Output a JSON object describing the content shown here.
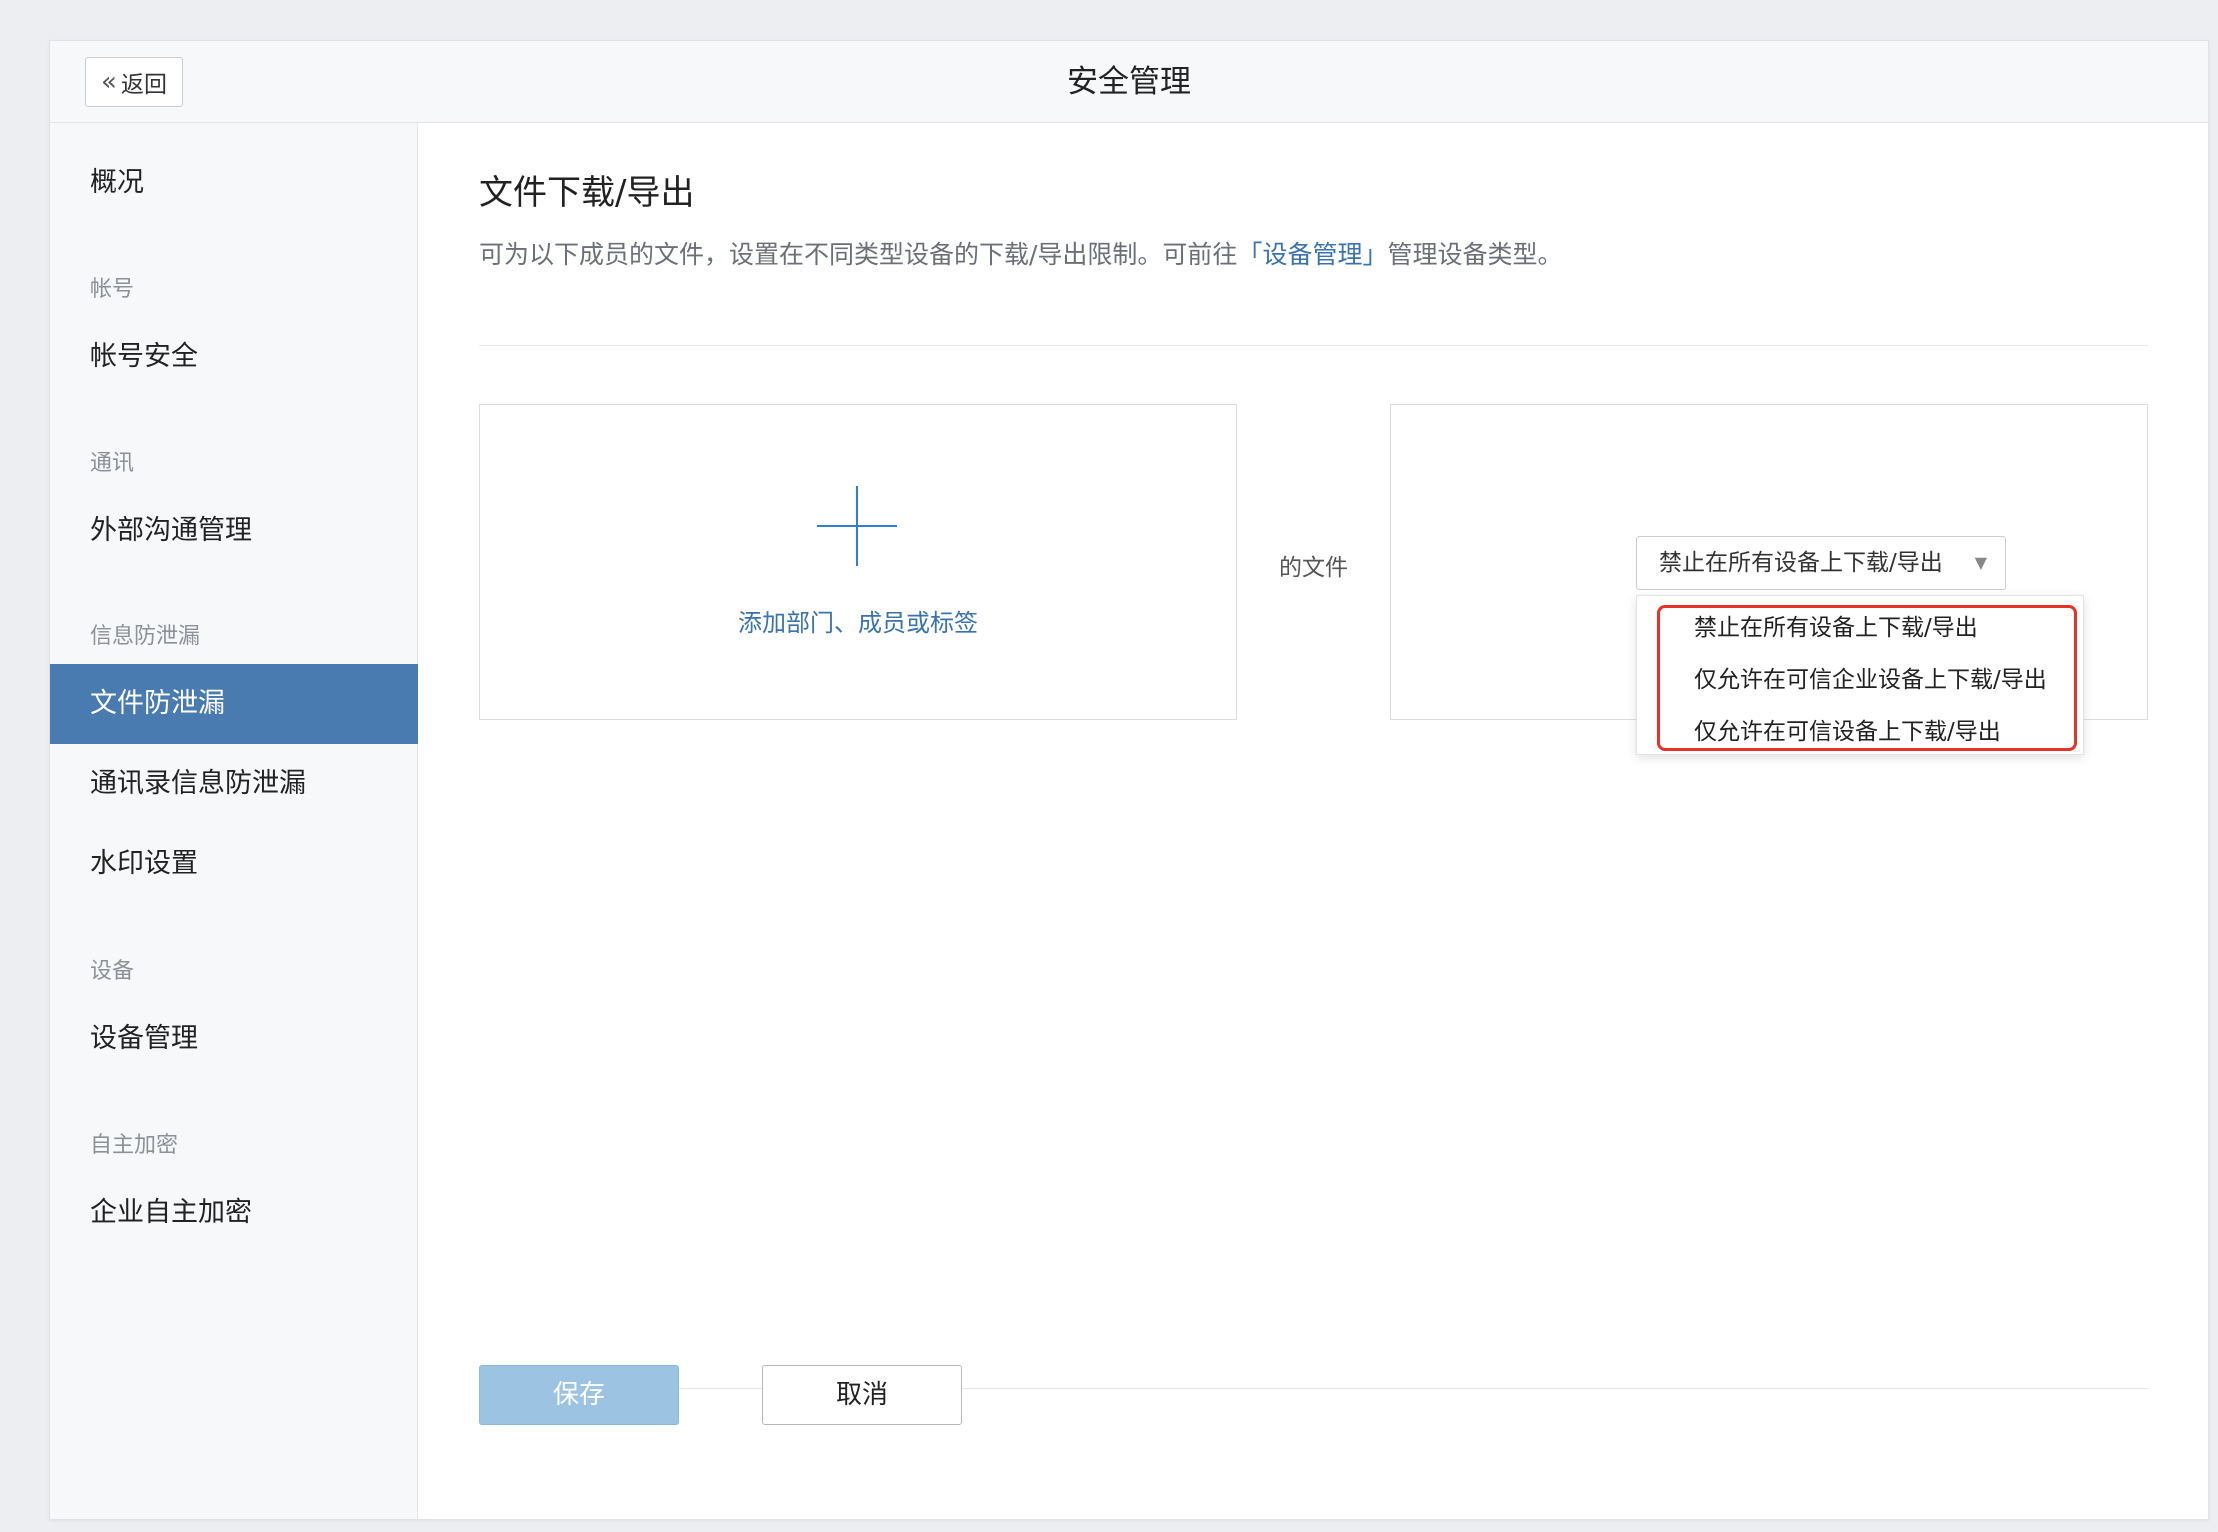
{
  "header": {
    "back_label": "返回",
    "title": "安全管理"
  },
  "sidebar": {
    "overview": "概况",
    "groups": [
      {
        "label": "帐号",
        "items": [
          "帐号安全"
        ]
      },
      {
        "label": "通讯",
        "items": [
          "外部沟通管理"
        ]
      },
      {
        "label": "信息防泄漏",
        "items": [
          "文件防泄漏",
          "通讯录信息防泄漏",
          "水印设置"
        ]
      },
      {
        "label": "设备",
        "items": [
          "设备管理"
        ]
      },
      {
        "label": "自主加密",
        "items": [
          "企业自主加密"
        ]
      }
    ],
    "active_item": "文件防泄漏"
  },
  "main": {
    "title": "文件下载/导出",
    "description_prefix": "可为以下成员的文件，设置在不同类型设备的下载/导出限制。可前往",
    "description_link": "「设备管理」",
    "description_suffix": "管理设备类型。",
    "add_label": "添加部门、成员或标签",
    "of_files": "的文件",
    "select_value": "禁止在所有设备上下载/导出",
    "options": [
      "禁止在所有设备上下载/导出",
      "仅允许在可信企业设备上下载/导出",
      "仅允许在可信设备上下载/导出"
    ],
    "save_label": "保存",
    "cancel_label": "取消"
  },
  "colors": {
    "accent": "#4a7bb0",
    "link": "#3a73ad",
    "plus": "#2f7fd6",
    "highlight": "#e5332a",
    "save_disabled": "#9dc3e3"
  }
}
